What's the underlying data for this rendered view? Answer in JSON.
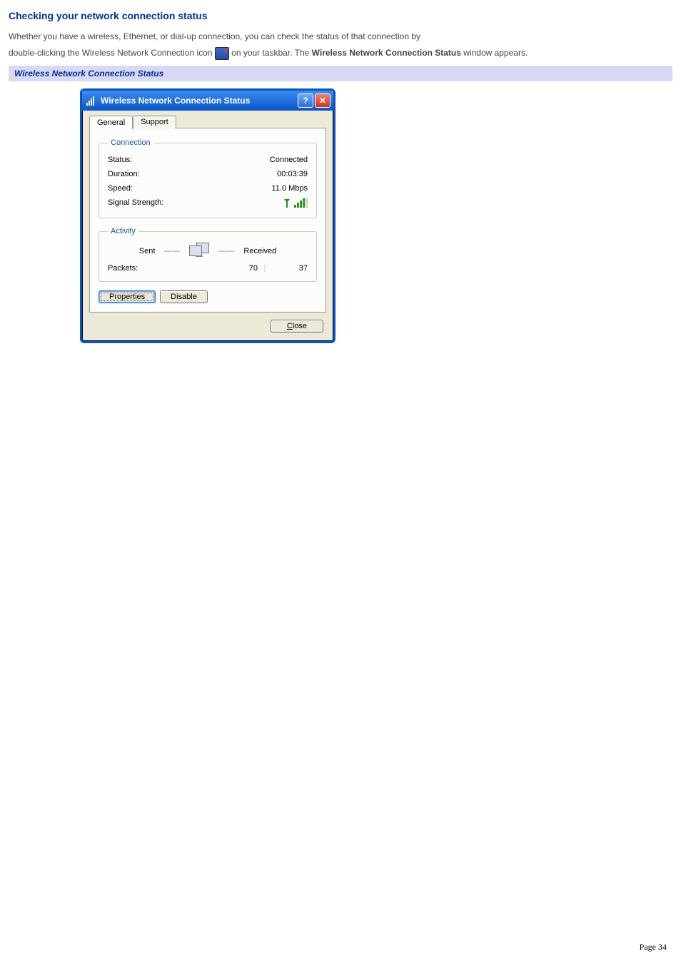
{
  "heading": "Checking your network connection status",
  "para1_a": "Whether you have a wireless, Ethernet, or dial-up connection, you can check the status of that connection by",
  "para1_b": "double-clicking the Wireless Network Connection icon ",
  "para1_c": " on your taskbar. The ",
  "para1_bold": "Wireless Network Connection Status",
  "para1_d": " window appears.",
  "caption": "Wireless Network Connection Status",
  "dialog": {
    "title": "Wireless Network Connection Status",
    "help_glyph": "?",
    "close_glyph": "✕",
    "tabs": {
      "general": "General",
      "support": "Support"
    },
    "groups": {
      "connection": "Connection",
      "activity": "Activity"
    },
    "conn": {
      "status_label": "Status:",
      "status_value": "Connected",
      "duration_label": "Duration:",
      "duration_value": "00:03:39",
      "speed_label": "Speed:",
      "speed_value": "11.0 Mbps",
      "signal_label": "Signal Strength:"
    },
    "activity": {
      "sent_label": "Sent",
      "received_label": "Received",
      "packets_label": "Packets:",
      "packets_sent": "70",
      "packets_received": "37",
      "dash": "——",
      "sep": "|"
    },
    "buttons": {
      "properties": "Properties",
      "disable": "Disable",
      "close_pre": "C",
      "close_post": "lose"
    }
  },
  "footer": {
    "page": "Page 34"
  }
}
